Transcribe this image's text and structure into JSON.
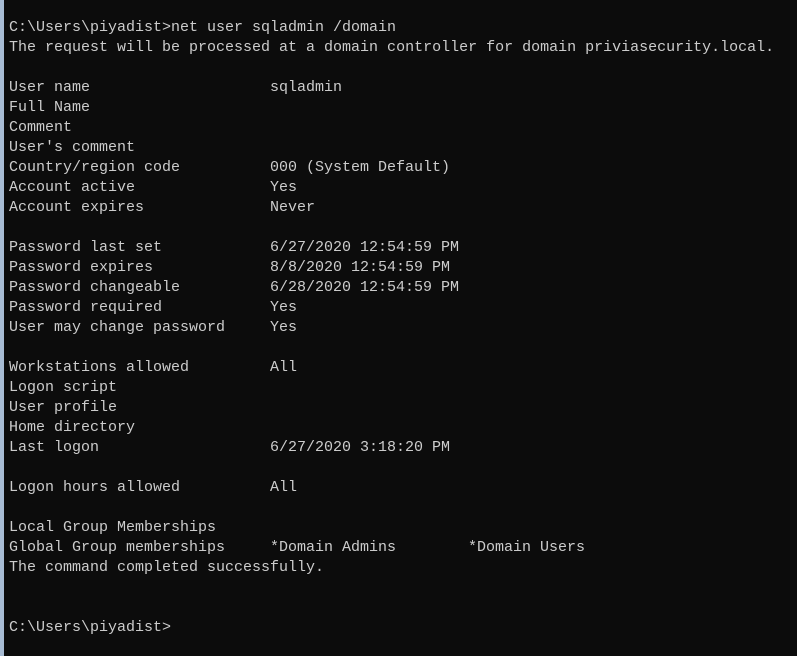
{
  "window": {
    "edge_color": "#a8bcd4",
    "background": "#0c0c0c",
    "text_color": "#cccccc"
  },
  "console": {
    "lines": [
      {
        "text": "C:\\Users\\piyadist>net user sqladmin /domain"
      },
      {
        "text": "The request will be processed at a domain controller for domain priviasecurity.local."
      },
      {
        "text": ""
      },
      {
        "label": "User name",
        "value": "sqladmin"
      },
      {
        "label": "Full Name",
        "value": ""
      },
      {
        "label": "Comment",
        "value": ""
      },
      {
        "label": "User's comment",
        "value": ""
      },
      {
        "label": "Country/region code",
        "value": "000 (System Default)"
      },
      {
        "label": "Account active",
        "value": "Yes"
      },
      {
        "label": "Account expires",
        "value": "Never"
      },
      {
        "text": ""
      },
      {
        "label": "Password last set",
        "value": "6/27/2020 12:54:59 PM"
      },
      {
        "label": "Password expires",
        "value": "8/8/2020 12:54:59 PM"
      },
      {
        "label": "Password changeable",
        "value": "6/28/2020 12:54:59 PM"
      },
      {
        "label": "Password required",
        "value": "Yes"
      },
      {
        "label": "User may change password",
        "value": "Yes"
      },
      {
        "text": ""
      },
      {
        "label": "Workstations allowed",
        "value": "All"
      },
      {
        "label": "Logon script",
        "value": ""
      },
      {
        "label": "User profile",
        "value": ""
      },
      {
        "label": "Home directory",
        "value": ""
      },
      {
        "label": "Last logon",
        "value": "6/27/2020 3:18:20 PM"
      },
      {
        "text": ""
      },
      {
        "label": "Logon hours allowed",
        "value": "All"
      },
      {
        "text": ""
      },
      {
        "label": "Local Group Memberships",
        "value": ""
      },
      {
        "label": "Global Group memberships",
        "value": "*Domain Admins",
        "value2": "*Domain Users"
      },
      {
        "text": "The command completed successfully."
      },
      {
        "text": ""
      },
      {
        "text": ""
      },
      {
        "text": "C:\\Users\\piyadist>"
      }
    ]
  }
}
